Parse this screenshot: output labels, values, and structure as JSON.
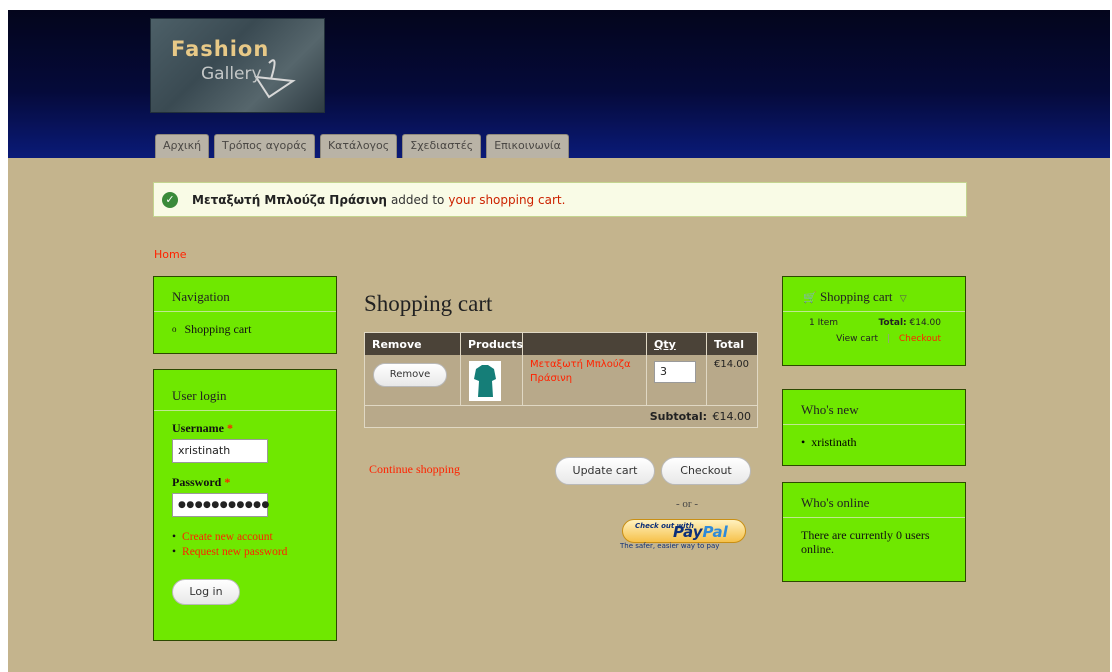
{
  "header": {
    "logo_line1": "Fashion",
    "logo_line2": "Gallery",
    "tabs": [
      "Αρχική",
      "Τρόπος αγοράς",
      "Κατάλογος",
      "Σχεδιαστές",
      "Επικοινωνία"
    ]
  },
  "message": {
    "product": "Μεταξωτή Μπλούζα Πράσινη",
    "text": "added to",
    "link": "your shopping cart."
  },
  "breadcrumb": "Home",
  "navigation": {
    "title": "Navigation",
    "items": [
      "Shopping cart"
    ]
  },
  "login": {
    "title": "User login",
    "username_label": "Username",
    "username_value": "xristinath",
    "password_label": "Password",
    "password_value": "●●●●●●●●●●●",
    "required_mark": "*",
    "links": [
      "Create new account",
      "Request new password"
    ],
    "button": "Log in"
  },
  "cart_page": {
    "title": "Shopping cart",
    "headers": [
      "Remove",
      "Products",
      "",
      "Qty",
      "Total"
    ],
    "rows": [
      {
        "remove": "Remove",
        "product": "Μεταξωτή Μπλούζα Πράσινη",
        "qty": "3",
        "total": "€14.00"
      }
    ],
    "subtotal_label": "Subtotal:",
    "subtotal_value": "€14.00",
    "continue": "Continue shopping",
    "update": "Update cart",
    "checkout": "Checkout",
    "or": "- or -",
    "paypal_small": "Check out with",
    "paypal_big1": "Pay",
    "paypal_big2": "Pal",
    "paypal_tagline": "The safer, easier way to pay"
  },
  "cart_block": {
    "title": "Shopping cart",
    "items": "1 Item",
    "total_label": "Total:",
    "total_value": "€14.00",
    "view": "View cart",
    "sep": "|",
    "checkout": "Checkout"
  },
  "whos_new": {
    "title": "Who's new",
    "items": [
      "xristinath"
    ]
  },
  "whos_online": {
    "title": "Who's online",
    "text": "There are currently 0 users online."
  },
  "colors": {
    "block": "#6fe800",
    "page_bg": "#c4b48d",
    "link": "#ff2200",
    "header": "#050a3a"
  }
}
